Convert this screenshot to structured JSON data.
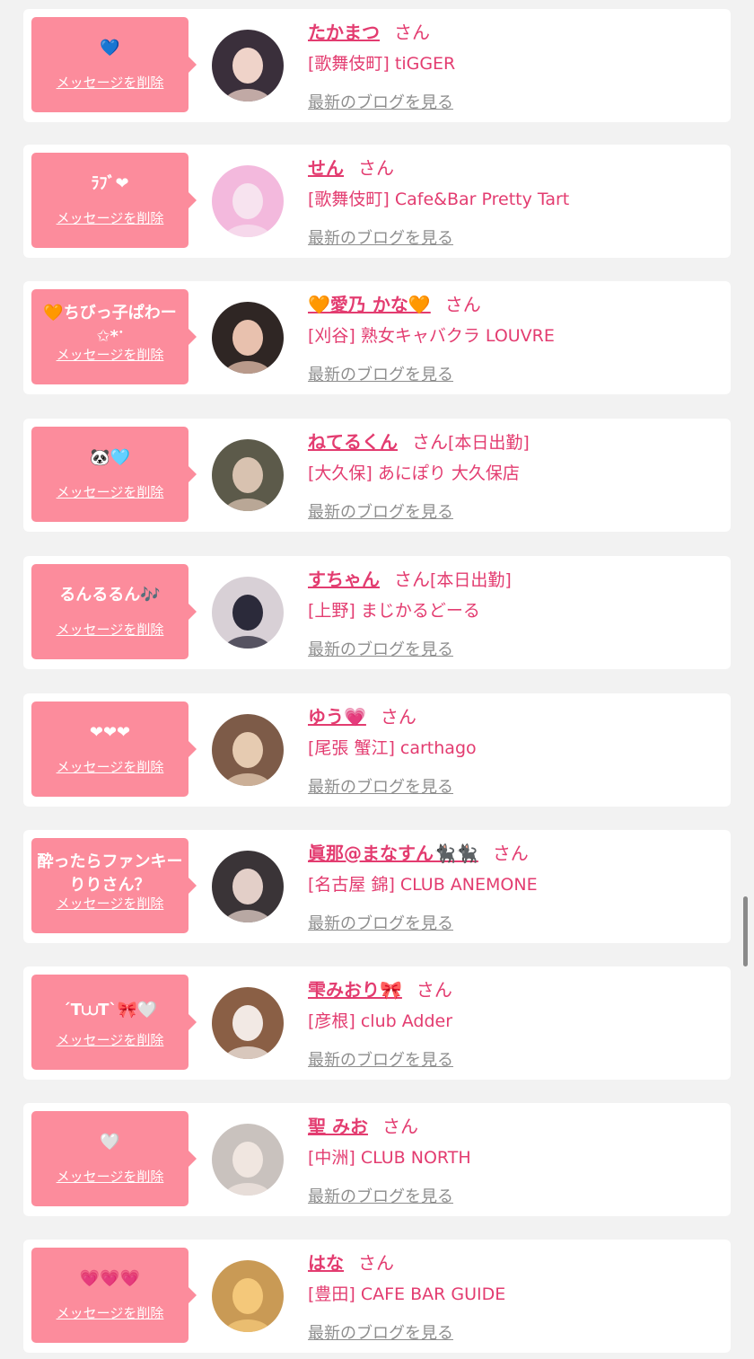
{
  "items": [
    {
      "message": "💙",
      "delete_label": "メッセージを削除",
      "name": "たかまつ",
      "honorific": "さん",
      "badge": "",
      "shop": "[歌舞伎町] tiGGER",
      "blog_link": "最新のブログを見る",
      "avatar_colors": [
        "#3a2f3b",
        "#efd3c9"
      ]
    },
    {
      "message": "ﾗﾌﾞ❤",
      "delete_label": "メッセージを削除",
      "name": "せん",
      "honorific": "さん",
      "badge": "",
      "shop": "[歌舞伎町] Cafe&Bar Pretty Tart",
      "blog_link": "最新のブログを見る",
      "avatar_colors": [
        "#f3b9dd",
        "#f7e3ef"
      ]
    },
    {
      "message": "🧡ちびっ子ぱわー✩*ॱ",
      "delete_label": "メッセージを削除",
      "name": "🧡愛乃 かな🧡",
      "honorific": "さん",
      "badge": "",
      "shop": "[刈谷] 熟女キャバクラ LOUVRE",
      "blog_link": "最新のブログを見る",
      "avatar_colors": [
        "#2f2624",
        "#e8c1ae"
      ]
    },
    {
      "message": "🐼🩵",
      "delete_label": "メッセージを削除",
      "name": "ねてるくん",
      "honorific": "さん",
      "badge": "[本日出勤]",
      "shop": "[大久保] あにぽり 大久保店",
      "blog_link": "最新のブログを見る",
      "avatar_colors": [
        "#5c5a4a",
        "#d8c2b0"
      ]
    },
    {
      "message": "るんるるん🎶",
      "delete_label": "メッセージを削除",
      "name": "すちゃん",
      "honorific": "さん",
      "badge": "[本日出勤]",
      "shop": "[上野] まじかるどーる",
      "blog_link": "最新のブログを見る",
      "avatar_colors": [
        "#d8d0d6",
        "#2b2a3a"
      ]
    },
    {
      "message": "❤❤❤",
      "delete_label": "メッセージを削除",
      "name": "ゆう💗",
      "honorific": "さん",
      "badge": "",
      "shop": "[尾張 蟹江] carthago",
      "blog_link": "最新のブログを見る",
      "avatar_colors": [
        "#7d5b48",
        "#e6cbb1"
      ]
    },
    {
      "message": "酔ったらファンキーりりさん？",
      "delete_label": "メッセージを削除",
      "name": "眞那@まなすん🐈‍⬛🐈‍⬛",
      "honorific": "さん",
      "badge": "",
      "shop": "[名古屋 錦] CLUB ANEMONE",
      "blog_link": "最新のブログを見る",
      "avatar_colors": [
        "#3a3437",
        "#e3cfc8"
      ]
    },
    {
      "message": "ˊT⩊Tˋ🎀🤍",
      "delete_label": "メッセージを削除",
      "name": "雫みおり🎀",
      "honorific": "さん",
      "badge": "",
      "shop": "[彦根] club Adder",
      "blog_link": "最新のブログを見る",
      "avatar_colors": [
        "#8a5f45",
        "#f2e9e4"
      ]
    },
    {
      "message": "🤍",
      "delete_label": "メッセージを削除",
      "name": "聖 みお",
      "honorific": "さん",
      "badge": "",
      "shop": "[中洲] CLUB NORTH",
      "blog_link": "最新のブログを見る",
      "avatar_colors": [
        "#c9c2be",
        "#f0e6e0"
      ]
    },
    {
      "message": "💗💗💗",
      "delete_label": "メッセージを削除",
      "name": "はな",
      "honorific": "さん",
      "badge": "",
      "shop": "[豊田] CAFE BAR GUIDE",
      "blog_link": "最新のブログを見る",
      "avatar_colors": [
        "#c99a55",
        "#f4c87a"
      ]
    }
  ]
}
